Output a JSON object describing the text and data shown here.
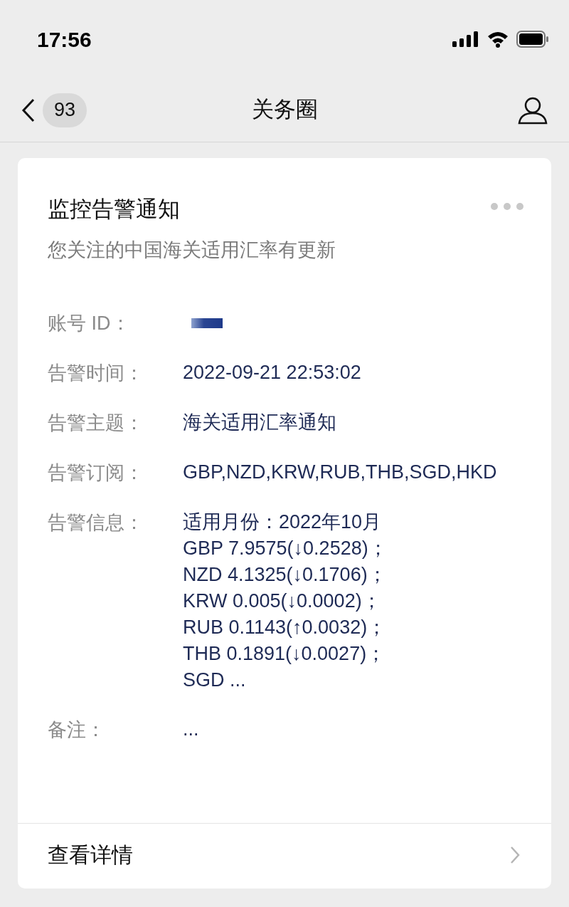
{
  "status_bar": {
    "time": "17:56"
  },
  "nav": {
    "back_badge": "93",
    "title": "关务圈"
  },
  "card": {
    "title": "监控告警通知",
    "subtitle": "您关注的中国海关适用汇率有更新",
    "rows": [
      {
        "kind": "redacted",
        "label": "账号 ID："
      },
      {
        "kind": "text",
        "label": "告警时间：",
        "lines": [
          "2022-09-21 22:53:02"
        ]
      },
      {
        "kind": "text",
        "label": "告警主题：",
        "lines": [
          "海关适用汇率通知"
        ]
      },
      {
        "kind": "text",
        "label": "告警订阅：",
        "lines": [
          "GBP,NZD,KRW,RUB,THB,SGD,HKD"
        ]
      },
      {
        "kind": "text",
        "label": "告警信息：",
        "lines": [
          "适用月份：2022年10月",
          "GBP 7.9575(↓0.2528)；",
          "NZD 4.1325(↓0.1706)；",
          "KRW 0.005(↓0.0002)；",
          "RUB 0.1143(↑0.0032)；",
          "THB 0.1891(↓0.0027)；",
          "SGD ..."
        ]
      },
      {
        "kind": "text",
        "label": "备注：",
        "lines": [
          "..."
        ]
      }
    ],
    "footer": "查看详情"
  }
}
